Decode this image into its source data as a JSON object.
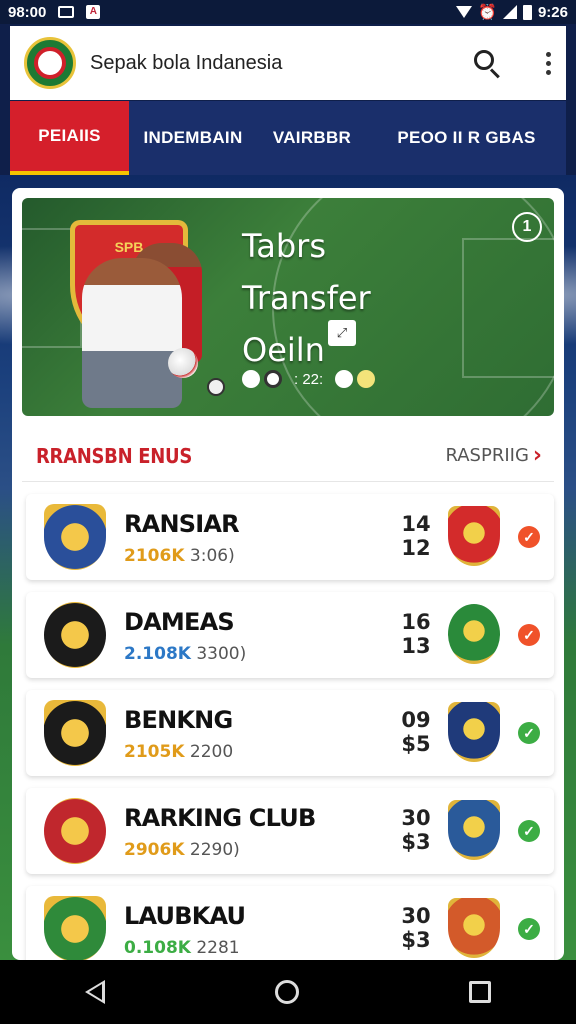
{
  "status_bar": {
    "time_left": "98:00",
    "time_right": "9:26"
  },
  "header": {
    "title": "Sepak bola Indanesia"
  },
  "tabs": [
    {
      "label": "PEIAIIS",
      "active": true
    },
    {
      "label": "INDEMBAIN",
      "active": false
    },
    {
      "label": "VAIRBBR",
      "active": false
    },
    {
      "label": "PEOO II R GBAS",
      "active": false
    }
  ],
  "banner": {
    "title_line1": "Tabrs",
    "title_line2": "Transfer",
    "title_line3": "Oeiln",
    "counter": "1",
    "time": ": 22:",
    "crest_text": "SPB"
  },
  "rankings": {
    "title": "RRANSBN ENUS",
    "link_label": "RASPRIIG",
    "rows": [
      {
        "name": "RANSIAR",
        "stat_highlight": "2106K",
        "stat_rest": "3:06)",
        "highlight_color": "#e09b1a",
        "score_top": "14",
        "score_bottom": "12",
        "check_color": "#f0522a",
        "logo_color": "#2a4f9a",
        "opp_color": "#d32b2b"
      },
      {
        "name": "DAMEAS",
        "stat_highlight": "2.108K",
        "stat_rest": "3300)",
        "highlight_color": "#2c78c6",
        "score_top": "16",
        "score_bottom": "13",
        "check_color": "#f0522a",
        "logo_color": "#1b1b1b",
        "opp_color": "#2a8a3a"
      },
      {
        "name": "BENKNG",
        "stat_highlight": "2105K",
        "stat_rest": "2200",
        "highlight_color": "#e09b1a",
        "score_top": "09",
        "score_bottom": "$5",
        "check_color": "#3cad44",
        "logo_color": "#1b1b1b",
        "opp_color": "#1f3a7a"
      },
      {
        "name": "RARKING CLUB",
        "stat_highlight": "2906K",
        "stat_rest": "2290)",
        "highlight_color": "#e09b1a",
        "score_top": "30",
        "score_bottom": "$3",
        "check_color": "#3cad44",
        "logo_color": "#c0272d",
        "opp_color": "#2a5a9a"
      },
      {
        "name": "LAUBKAU",
        "stat_highlight": "0.108K",
        "stat_rest": "2281",
        "highlight_color": "#3cad44",
        "score_top": "30",
        "score_bottom": "$3",
        "check_color": "#3cad44",
        "logo_color": "#2f8a3a",
        "opp_color": "#d35a2a"
      }
    ]
  },
  "icons": {
    "search": "search-icon",
    "more": "more-vertical-icon",
    "check": "check-icon"
  }
}
